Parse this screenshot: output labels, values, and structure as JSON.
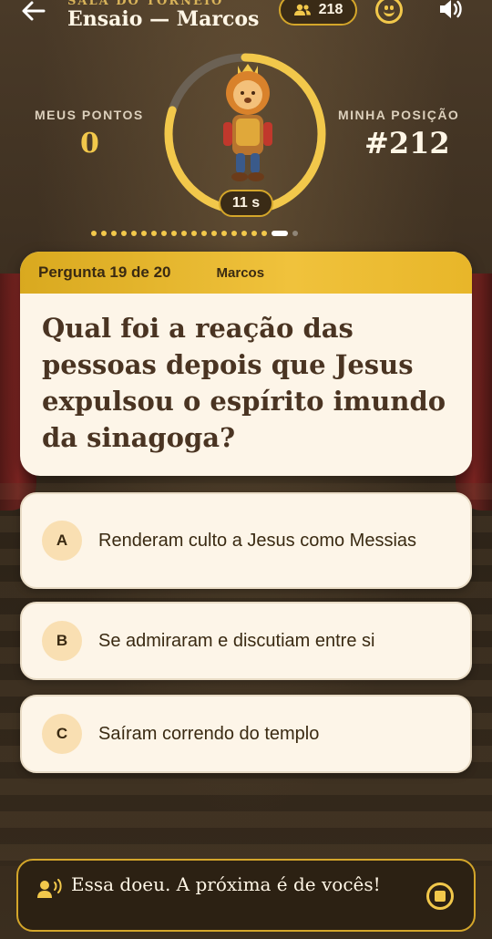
{
  "header": {
    "caption": "SALA DO TORNEIO",
    "title": "Ensaio — Marcos",
    "players_count": "218"
  },
  "scores": {
    "my_points_label": "MEUS PONTOS",
    "my_points_value": "0",
    "my_position_label": "MINHA POSIÇÃO",
    "my_position_value": "#212"
  },
  "timer": {
    "label": "11 s",
    "remaining_fraction": 0.8
  },
  "progress": {
    "total_questions": 20,
    "current_question": 19
  },
  "question": {
    "counter": "Pergunta 19 de 20",
    "book": "Marcos",
    "text": "Qual foi a reação das pessoas depois que Jesus expulsou o espírito imundo da sinagoga?"
  },
  "options": [
    {
      "letter": "A",
      "text": "Renderam culto a Jesus como Messias"
    },
    {
      "letter": "B",
      "text": "Se admiraram e discutiam entre si"
    },
    {
      "letter": "C",
      "text": "Saíram correndo do templo"
    }
  ],
  "narrator": {
    "message": "Essa doeu. A próxima é de vocês!"
  },
  "colors": {
    "accent_gold": "#f2c84b",
    "card_bg": "#fdf5e8",
    "text_dark": "#3a2a12"
  },
  "icons": {
    "back": "arrow-left-icon",
    "players": "people-icon",
    "emoji": "smiley-icon",
    "sound": "volume-icon",
    "speaker": "speaking-person-icon",
    "stop": "stop-icon"
  }
}
